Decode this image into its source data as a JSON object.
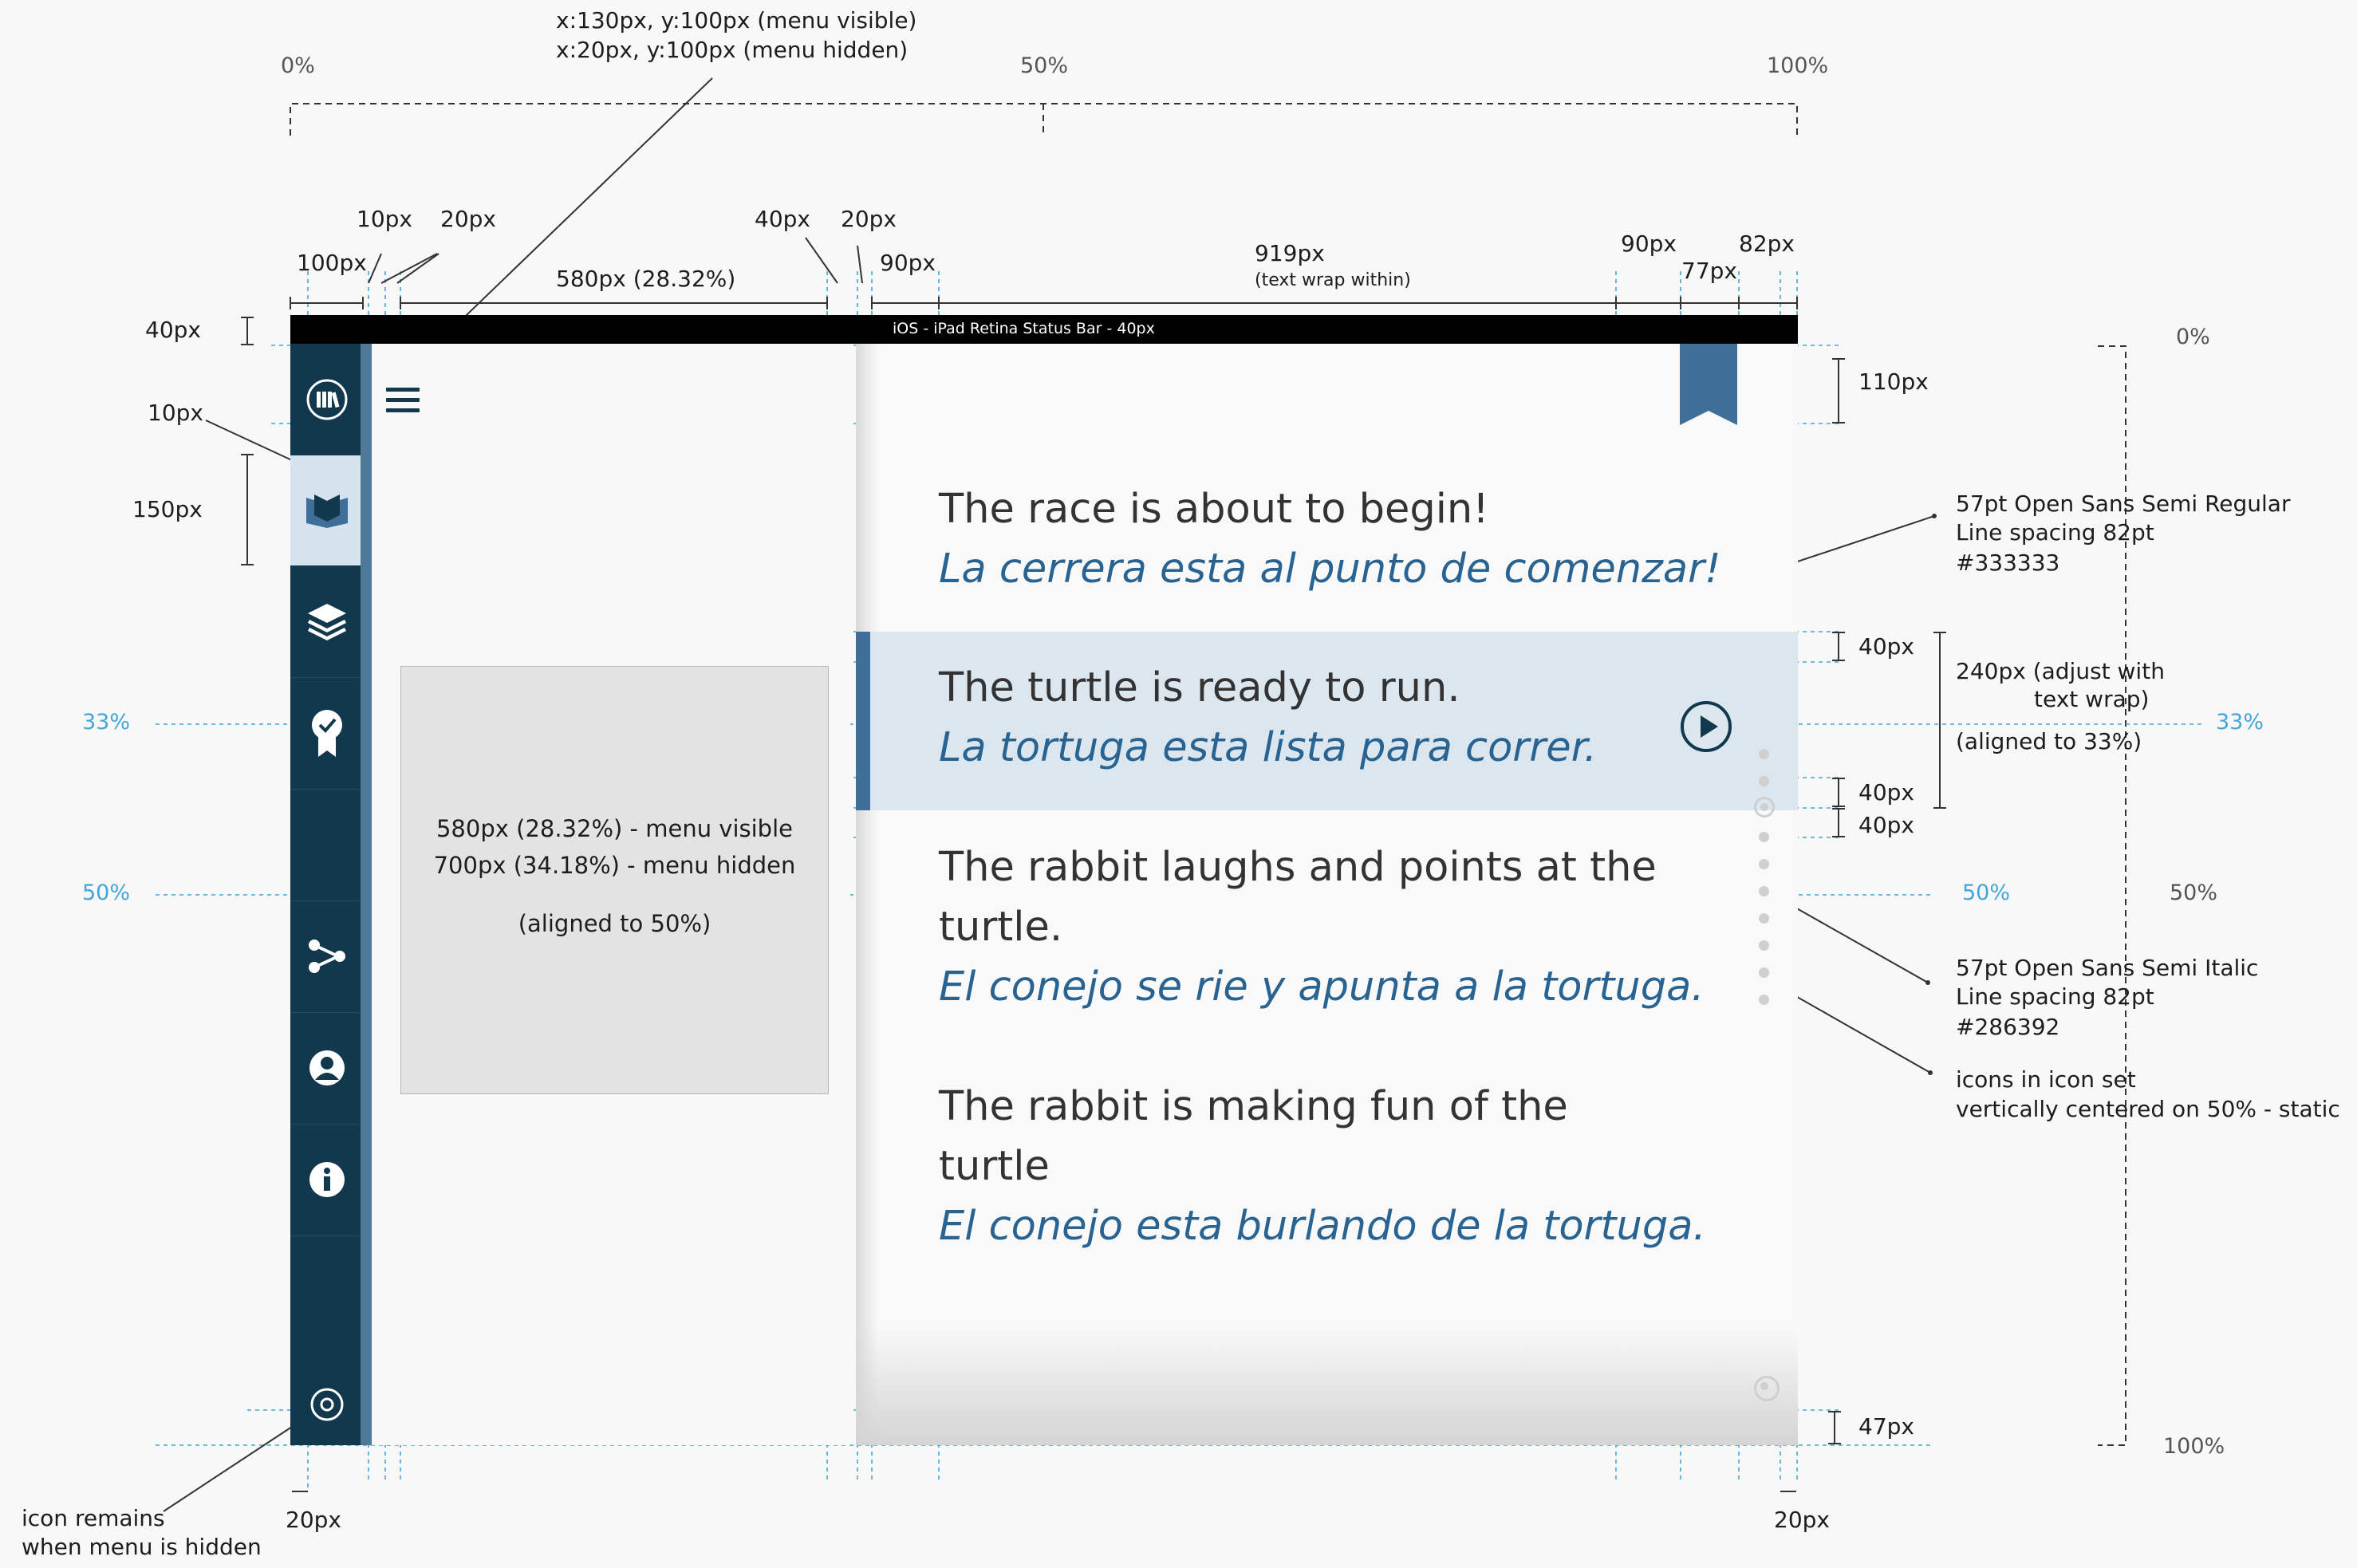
{
  "header": {
    "scale": [
      "0%",
      "50%",
      "100%"
    ],
    "menu_pos_visible": "x:130px, y:100px (menu visible)",
    "menu_pos_hidden": "x:20px, y:100px (menu hidden)"
  },
  "measures": {
    "m10a": "10px",
    "m20a": "20px",
    "m100": "100px",
    "m580": "580px (28.32%)",
    "m40a": "40px",
    "m20b": "20px",
    "m90a": "90px",
    "m919": "919px",
    "m919_note": "(text wrap within)",
    "m90b": "90px",
    "m77": "77px",
    "m82": "82px",
    "left40": "40px",
    "left10": "10px",
    "left150": "150px",
    "r110": "110px",
    "r40a": "40px",
    "r40b": "40px",
    "r40c": "40px",
    "r47": "47px",
    "bottom20a": "20px",
    "bottom20b": "20px"
  },
  "status_bar": "iOS - iPad Retina Status Bar - 40px",
  "guides": {
    "p33": "33%",
    "p50": "50%",
    "p50_right": "50%",
    "p33_right": "33%"
  },
  "right_scale": {
    "p0": "0%",
    "p50": "50%",
    "p100": "100%"
  },
  "grey_box": {
    "line1": "580px (28.32%) - menu visible",
    "line2": "700px (34.18%) - menu hidden",
    "line3": "(aligned to 50%)"
  },
  "story": [
    {
      "en": "The race is about to begin!",
      "es": "La cerrera esta al punto de comenzar!"
    },
    {
      "en": "The turtle is ready to run.",
      "es": "La tortuga esta lista para correr."
    },
    {
      "en1": "The rabbit laughs and points at the",
      "en2": "turtle.",
      "es": "El conejo se rie y apunta a la tortuga."
    },
    {
      "en1": "The rabbit is making fun of the",
      "en2": "turtle",
      "es": "El conejo esta burlando de la tortuga."
    }
  ],
  "notes": {
    "font_regular": [
      "57pt Open Sans Semi Regular",
      "Line spacing 82pt",
      "#333333"
    ],
    "row_height": [
      "240px  (adjust with",
      "text wrap)",
      "(aligned to 33%)"
    ],
    "font_italic": [
      "57pt Open Sans Semi Italic",
      "Line spacing 82pt",
      "#286392"
    ],
    "icon_set": [
      "icons in icon set",
      "vertically centered on 50% - static"
    ],
    "icon_remains": [
      "icon remains",
      "when menu is hidden"
    ]
  },
  "sidebar_icons": [
    "library-icon",
    "book-icon",
    "layers-icon",
    "award-icon",
    "share-icon",
    "user-icon",
    "info-icon",
    "settings-icon"
  ],
  "colors": {
    "sidebar": "#12384d",
    "english_text": "#333333",
    "spanish_text": "#286392",
    "highlight": "#dce6ef",
    "guide": "#43a6d8"
  }
}
